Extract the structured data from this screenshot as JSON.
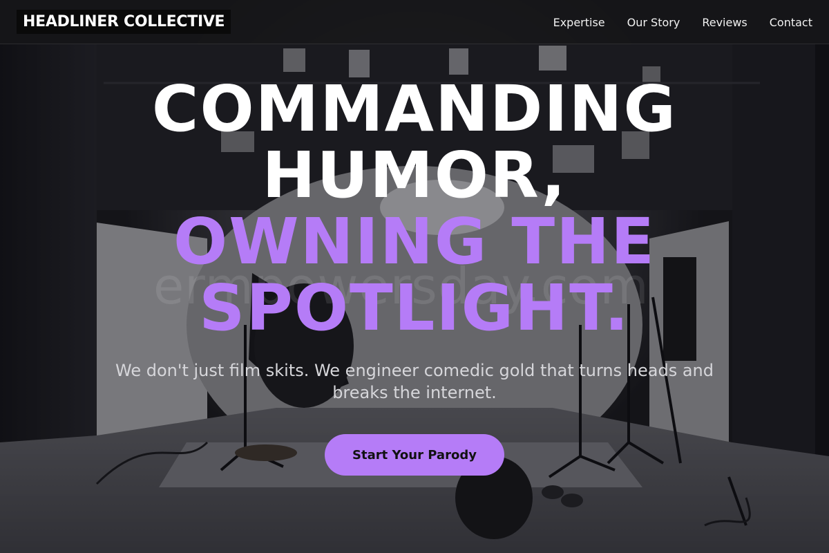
{
  "header": {
    "logo": "HEADLINER COLLECTIVE",
    "nav": [
      {
        "label": "Expertise"
      },
      {
        "label": "Our Story"
      },
      {
        "label": "Reviews"
      },
      {
        "label": "Contact"
      }
    ]
  },
  "hero": {
    "headline_line1": "COMMANDING",
    "headline_line2": "HUMOR,",
    "headline_line3": "OWNING THE",
    "headline_line4": "SPOTLIGHT.",
    "subtext": "We don't just film skits. We engineer comedic gold that turns heads and breaks the internet.",
    "cta_label": "Start Your Parody",
    "watermark": "ermpowersday.com"
  },
  "colors": {
    "accent": "#b57cf7",
    "header_bg": "#161618",
    "text_light": "#ffffff"
  }
}
